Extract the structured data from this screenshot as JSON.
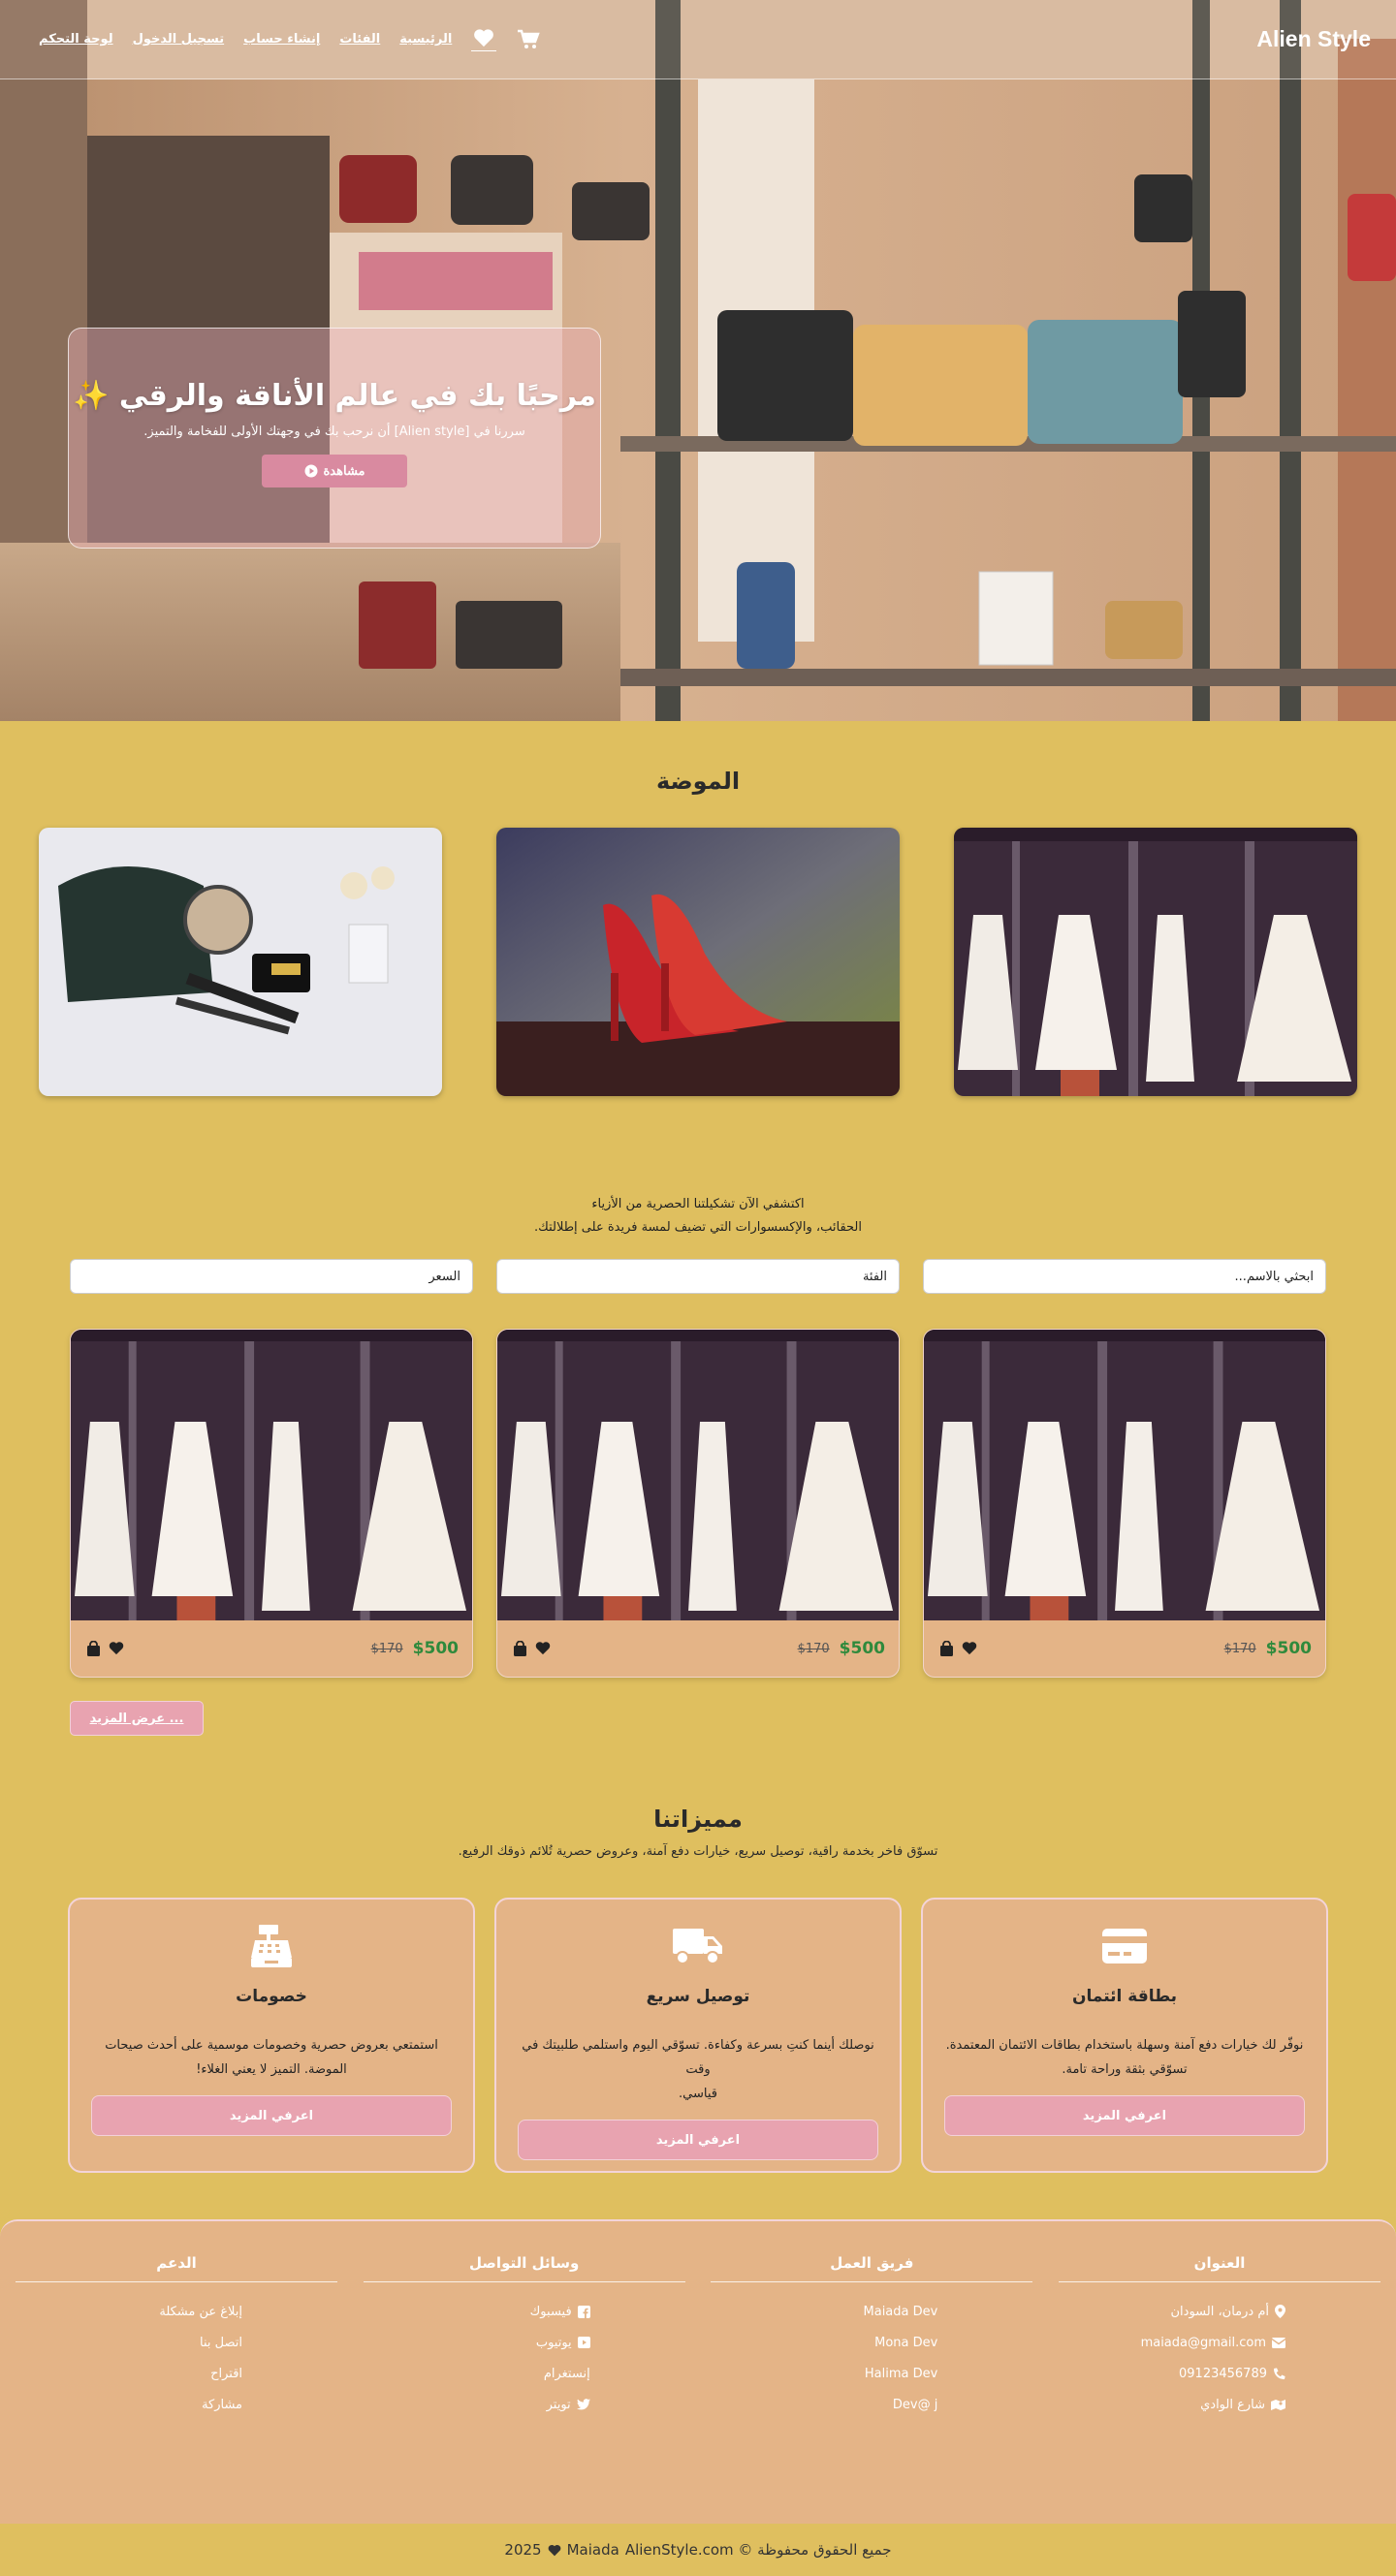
{
  "navbar": {
    "brand": "Alien Style",
    "links": [
      "الرئيسية",
      "الفئات",
      "إنشاء حساب",
      "تسجيل الدخول",
      "لوحة التحكم"
    ]
  },
  "hero": {
    "title": "مرحبًا بك في عالم الأناقة والرقي ✨",
    "subtitle": "سررنا في [Alien style] أن نرحب بك في وجهتك الأولى للفخامة والتميز.",
    "watch_label": "مشاهدة"
  },
  "fashion": {
    "title": "الموضة",
    "intro_line1": "اكتشفي الآن تشكيلتنا الحصرية من الأزياء",
    "intro_line2": "الحقائب، والإكسسوارات التي تضيف لمسة فريدة على إطلالتك."
  },
  "filters": {
    "search_placeholder": "ابحثي بالاسم...",
    "category_placeholder": "الفئة",
    "price_placeholder": "السعر"
  },
  "products": [
    {
      "price": "$500",
      "old_price": "$170"
    },
    {
      "price": "$500",
      "old_price": "$170"
    },
    {
      "price": "$500",
      "old_price": "$170"
    }
  ],
  "more_label": "عرض المزيد ...",
  "features": {
    "title": "مميزاتنا",
    "subtitle": "تسوّق فاخر بخدمة راقية، توصيل سريع، خيارات دفع آمنة، وعروض حصرية تُلائم ذوقك الرفيع.",
    "items": [
      {
        "icon": "credit-card-icon",
        "title": "بطاقة ائتمان",
        "line1": "نوفّر لك خيارات دفع آمنة وسهلة باستخدام بطاقات الائتمان المعتمدة.",
        "line2": "تسوّقي بثقة وراحة تامة.",
        "button": "اعرفي المزيد"
      },
      {
        "icon": "truck-icon",
        "title": "توصيل سريع",
        "line1": "نوصلك أينما كنتِ بسرعة وكفاءة. تسوّقي اليوم واستلمي طلبيتك في وقت",
        "line2": "قياسي.",
        "button": "اعرفي المزيد"
      },
      {
        "icon": "cash-register-icon",
        "title": "خصومات",
        "line1": "استمتعي بعروض حصرية وخصومات موسمية على أحدث صيحات",
        "line2": "الموضة. التميز لا يعني الغلاء!",
        "button": "اعرفي المزيد"
      }
    ]
  },
  "footer": {
    "address": {
      "title": "العنوان",
      "location": "أم درمان، السودان",
      "email": "maiada@gmail.com",
      "phone": "09123456789",
      "street": "شارع الوادي"
    },
    "team": {
      "title": "فريق العمل",
      "members": [
        "Maiada Dev",
        "Mona Dev",
        "Halima Dev",
        "Dev@ j"
      ]
    },
    "social": {
      "title": "وسائل التواصل",
      "facebook": "فيسبوك",
      "youtube": "يوتيوب",
      "instagram": "إنستغرام",
      "twitter": "تويتر"
    },
    "support": {
      "title": "الدعم",
      "links": [
        "إبلاغ عن مشكلة",
        "اتصل بنا",
        "اقتراح",
        "مشاركة"
      ]
    },
    "copyright_year": "2025",
    "copyright_name": "Maiada",
    "copyright_text": "جميع الحقوق محفوظة © AlienStyle.com"
  },
  "colors": {
    "background": "#dfbf5f",
    "card": "#e4b487",
    "pink_button": "#e8a3b0",
    "price_green": "#2f8a3c"
  }
}
